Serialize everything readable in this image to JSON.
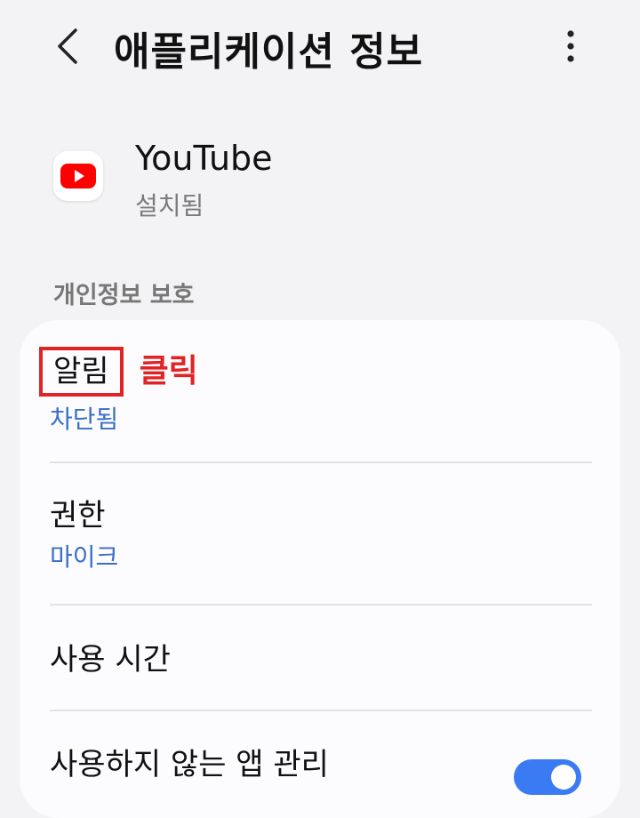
{
  "header": {
    "back_icon": "chevron-left-icon",
    "title": "애플리케이션 정보",
    "more_icon": "more-vertical-icon"
  },
  "app": {
    "icon": "youtube-icon",
    "name": "YouTube",
    "status": "설치됨"
  },
  "section": {
    "label": "개인정보 보호"
  },
  "items": [
    {
      "title": "알림",
      "subtitle": "차단됨"
    },
    {
      "title": "권한",
      "subtitle": "마이크"
    },
    {
      "title": "사용 시간"
    },
    {
      "title": "사용하지 않는 앱 관리",
      "toggle_on": true
    }
  ],
  "annotation": {
    "text": "클릭",
    "color": "#e02424"
  },
  "colors": {
    "background": "#f3f3f5",
    "card": "#fcfcfe",
    "link_blue": "#3a6fc4",
    "toggle_blue": "#3a7bf4",
    "youtube_red": "#ff0000"
  }
}
